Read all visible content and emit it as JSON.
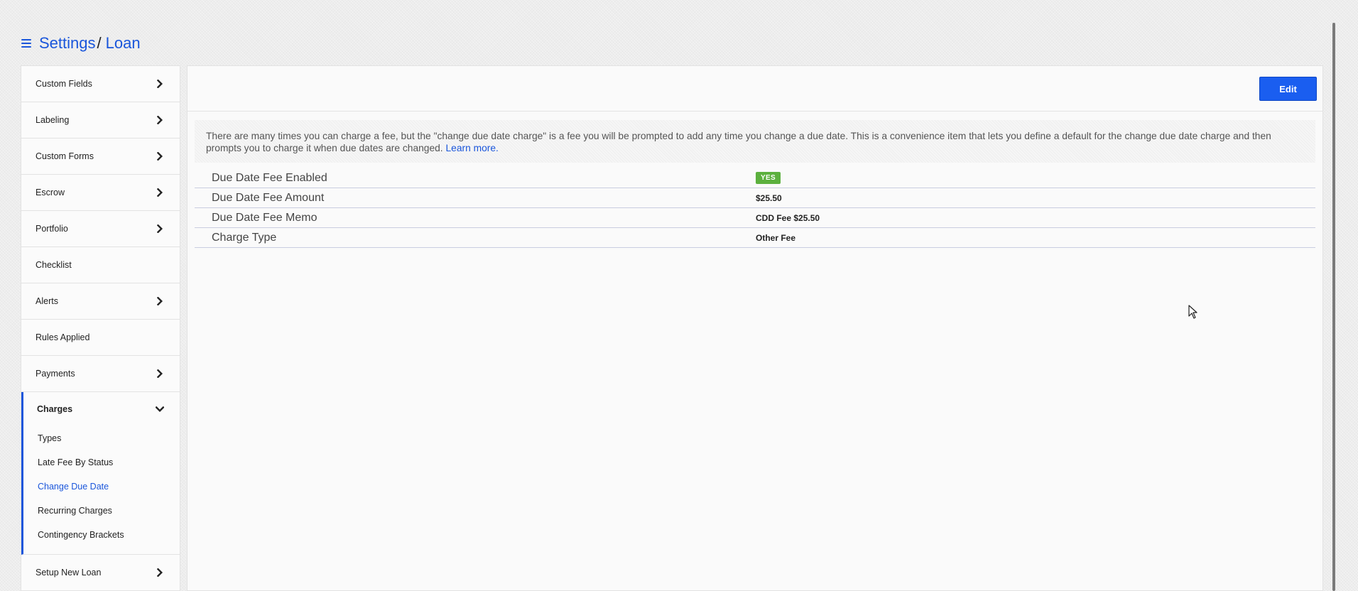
{
  "header": {
    "breadcrumb": [
      "Settings",
      "Loan"
    ],
    "separator": "/"
  },
  "icons": {
    "menu": "hamburger-icon",
    "nav_arrow": "chevron-right-icon",
    "expanded_arrow": "chevron-down-icon"
  },
  "sidebar": {
    "items": [
      {
        "label": "Custom Fields",
        "has_arrow": true
      },
      {
        "label": "Labeling",
        "has_arrow": true
      },
      {
        "label": "Custom Forms",
        "has_arrow": true
      },
      {
        "label": "Escrow",
        "has_arrow": true
      },
      {
        "label": "Portfolio",
        "has_arrow": true
      },
      {
        "label": "Checklist",
        "has_arrow": false
      },
      {
        "label": "Alerts",
        "has_arrow": true
      },
      {
        "label": "Rules Applied",
        "has_arrow": false
      },
      {
        "label": "Payments",
        "has_arrow": true
      }
    ],
    "expanded": {
      "label": "Charges",
      "children": [
        "Types",
        "Late Fee By Status",
        "Change Due Date",
        "Recurring Charges",
        "Contingency Brackets"
      ],
      "active_child": "Change Due Date"
    },
    "bottom_item": {
      "label": "Setup New Loan",
      "has_arrow": true
    }
  },
  "toolbar": {
    "edit_label": "Edit"
  },
  "info": {
    "text": "There are many times you can charge a fee, but the \"change due date charge\" is a fee you will be prompted to add any time you change a due date. This is a convenience item that lets you define a default for the change due date charge and then prompts you to charge it when due dates are changed.",
    "link_text": "Learn more."
  },
  "settings": [
    {
      "label": "Due Date Fee Enabled",
      "value": "YES",
      "is_badge": true
    },
    {
      "label": "Due Date Fee Amount",
      "value": "$25.50",
      "is_badge": false
    },
    {
      "label": "Due Date Fee Memo",
      "value": "CDD Fee $25.50",
      "is_badge": false
    },
    {
      "label": "Charge Type",
      "value": "Other Fee",
      "is_badge": false
    }
  ],
  "colors": {
    "accent": "#1a56db",
    "button": "#1a5ef0",
    "badge_green": "#5cb03e"
  }
}
